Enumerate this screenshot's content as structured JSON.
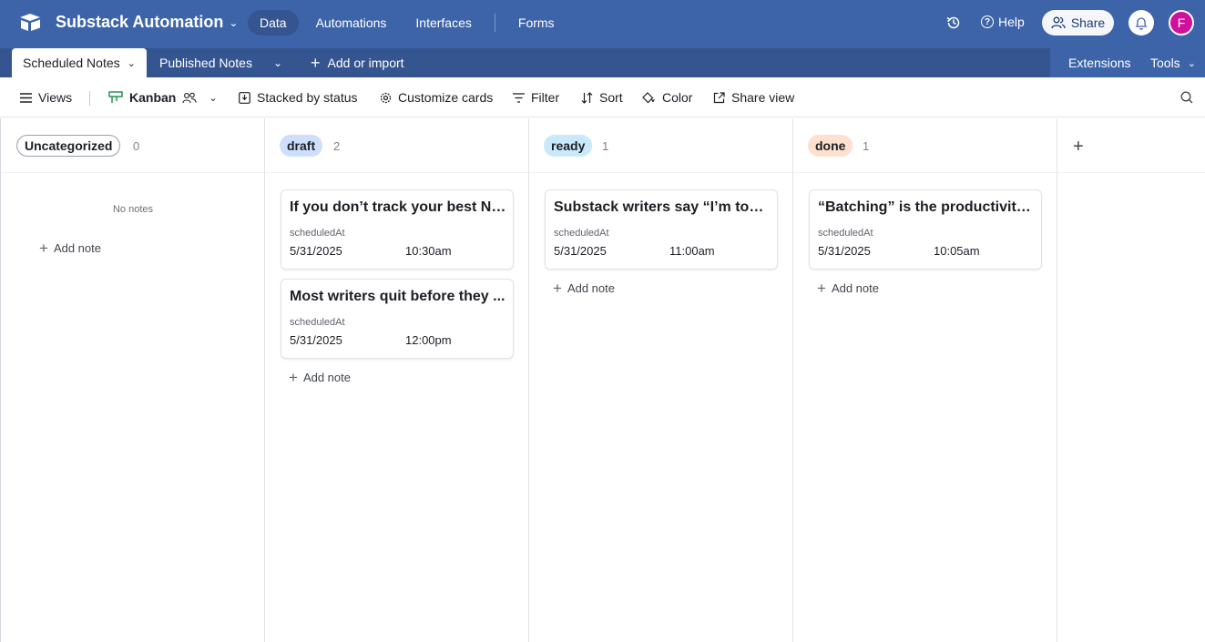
{
  "app": {
    "base_title": "Substack Automation",
    "nav": [
      "Data",
      "Automations",
      "Interfaces",
      "Forms"
    ],
    "help": "Help",
    "share": "Share",
    "avatar_initial": "F",
    "accent": "#3d64a8",
    "avatar_color": "#d0109a"
  },
  "tabs": {
    "active": "Scheduled Notes",
    "second": "Published Notes",
    "add_import": "Add or import",
    "extensions": "Extensions",
    "tools": "Tools"
  },
  "viewbar": {
    "views": "Views",
    "view_name": "Kanban",
    "stacked": "Stacked by status",
    "customize": "Customize cards",
    "filter": "Filter",
    "sort": "Sort",
    "color": "Color",
    "share_view": "Share view"
  },
  "columns": [
    {
      "label": "Uncategorized",
      "count": "0",
      "color": "#ffffff",
      "empty_text": "No notes",
      "add": "Add note",
      "cards": []
    },
    {
      "label": "draft",
      "count": "2",
      "color": "#cfdffb",
      "add": "Add note",
      "cards": [
        {
          "title": "If you don’t track your best No...",
          "field": "scheduledAt",
          "date": "5/31/2025",
          "time": "10:30am"
        },
        {
          "title": "Most writers quit before they ...",
          "field": "scheduledAt",
          "date": "5/31/2025",
          "time": "12:00pm"
        }
      ]
    },
    {
      "label": "ready",
      "count": "1",
      "color": "#c8e9fa",
      "add": "Add note",
      "cards": [
        {
          "title": "Substack writers say “I’m too ...",
          "field": "scheduledAt",
          "date": "5/31/2025",
          "time": "11:00am"
        }
      ]
    },
    {
      "label": "done",
      "count": "1",
      "color": "#fde0cf",
      "add": "Add note",
      "cards": [
        {
          "title": "“Batching” is the productivity ...",
          "field": "scheduledAt",
          "date": "5/31/2025",
          "time": "10:05am"
        }
      ]
    }
  ]
}
